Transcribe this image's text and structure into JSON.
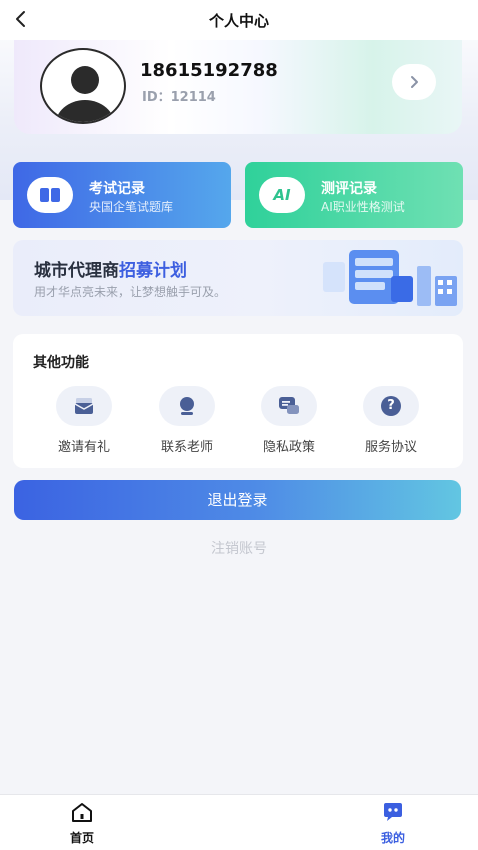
{
  "nav": {
    "title": "个人中心"
  },
  "profile": {
    "phone": "18615192788",
    "id_text": "ID：12114"
  },
  "records": [
    {
      "title": "考试记录",
      "subtitle": "央国企笔试题库",
      "icon": "book-icon"
    },
    {
      "title": "测评记录",
      "subtitle": "AI职业性格测试",
      "icon": "ai-icon",
      "icon_text": "AI"
    }
  ],
  "banner": {
    "title_a": "城市代理商",
    "title_b": "招募计划",
    "subtitle": "用才华点亮未来，让梦想触手可及。"
  },
  "other": {
    "title": "其他功能",
    "items": [
      {
        "label": "邀请有礼",
        "icon": "invite-envelope-icon"
      },
      {
        "label": "联系老师",
        "icon": "contact-teacher-icon"
      },
      {
        "label": "隐私政策",
        "icon": "privacy-chat-icon"
      },
      {
        "label": "服务协议",
        "icon": "question-help-icon",
        "icon_text": "?"
      }
    ]
  },
  "actions": {
    "logout": "退出登录",
    "cancel_account": "注销账号"
  },
  "tabbar": {
    "home": "首页",
    "mine": "我的"
  },
  "colors": {
    "accent": "#3b5fe0",
    "exam_card": "#3f68e6",
    "eval_card": "#2fd19a",
    "icon_fill": "#4a5f96"
  }
}
